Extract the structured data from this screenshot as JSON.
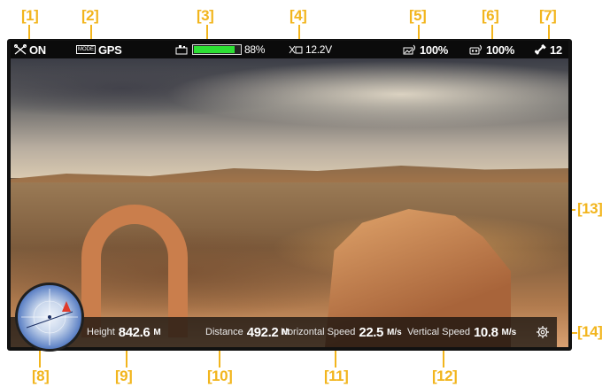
{
  "callouts": [
    "[1]",
    "[2]",
    "[3]",
    "[4]",
    "[5]",
    "[6]",
    "[7]",
    "[8]",
    "[9]",
    "[10]",
    "[11]",
    "[12]",
    "[13]",
    "[14]"
  ],
  "status_bar": {
    "aircraft_status": "ON",
    "mode_badge": "MODE",
    "mode_value": "GPS",
    "battery_percent_label": "88%",
    "battery_level": 0.88,
    "voltage": "12.2V",
    "image_transmission_signal": "100%",
    "rc_signal": "100%",
    "satellites": "12"
  },
  "telemetry": {
    "height_label": "Height",
    "height_value": "842.6",
    "height_unit": "M",
    "distance_label": "Distance",
    "distance_value": "492.2",
    "distance_unit": "M",
    "hspeed_label": "Horizontal Speed",
    "hspeed_value": "22.5",
    "hspeed_unit": "M/s",
    "vspeed_label": "Vertical Speed",
    "vspeed_value": "10.8",
    "vspeed_unit": "M/s"
  },
  "colors": {
    "callout": "#f2b51d",
    "battery_fill": "#2de034",
    "compass_marker": "#e03a2a"
  },
  "icons": [
    "drone-status-icon",
    "mode-icon",
    "battery-icon",
    "voltage-icon",
    "image-signal-icon",
    "rc-signal-icon",
    "satellite-icon",
    "settings-gear-icon",
    "compass-icon"
  ]
}
